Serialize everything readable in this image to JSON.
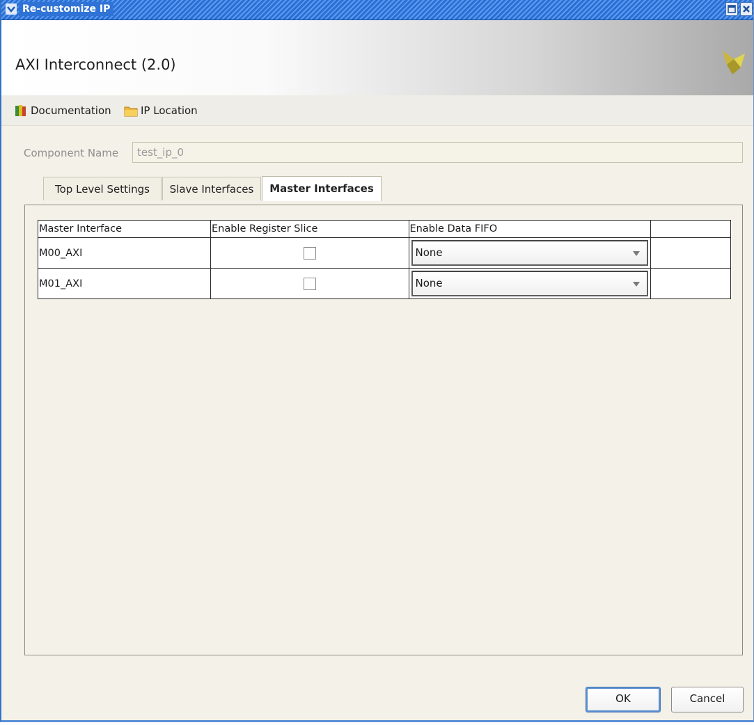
{
  "window": {
    "title": "Re-customize IP"
  },
  "header": {
    "ip_title": "AXI Interconnect (2.0)"
  },
  "toolbar": {
    "documentation": "Documentation",
    "ip_location": "IP Location"
  },
  "component": {
    "label": "Component Name",
    "value": "test_ip_0"
  },
  "tabs": [
    {
      "label": "Top Level Settings",
      "active": false
    },
    {
      "label": "Slave Interfaces",
      "active": false
    },
    {
      "label": "Master Interfaces",
      "active": true
    }
  ],
  "table": {
    "headers": [
      "Master Interface",
      "Enable Register Slice",
      "Enable Data FIFO",
      ""
    ],
    "rows": [
      {
        "name": "M00_AXI",
        "register_slice": false,
        "data_fifo": "None"
      },
      {
        "name": "M01_AXI",
        "register_slice": false,
        "data_fifo": "None"
      }
    ]
  },
  "buttons": {
    "ok": "OK",
    "cancel": "Cancel"
  },
  "colors": {
    "titlebar": "#2a6fd3",
    "window_bg": "#f4f1e8",
    "accent": "#5a8fd2"
  }
}
